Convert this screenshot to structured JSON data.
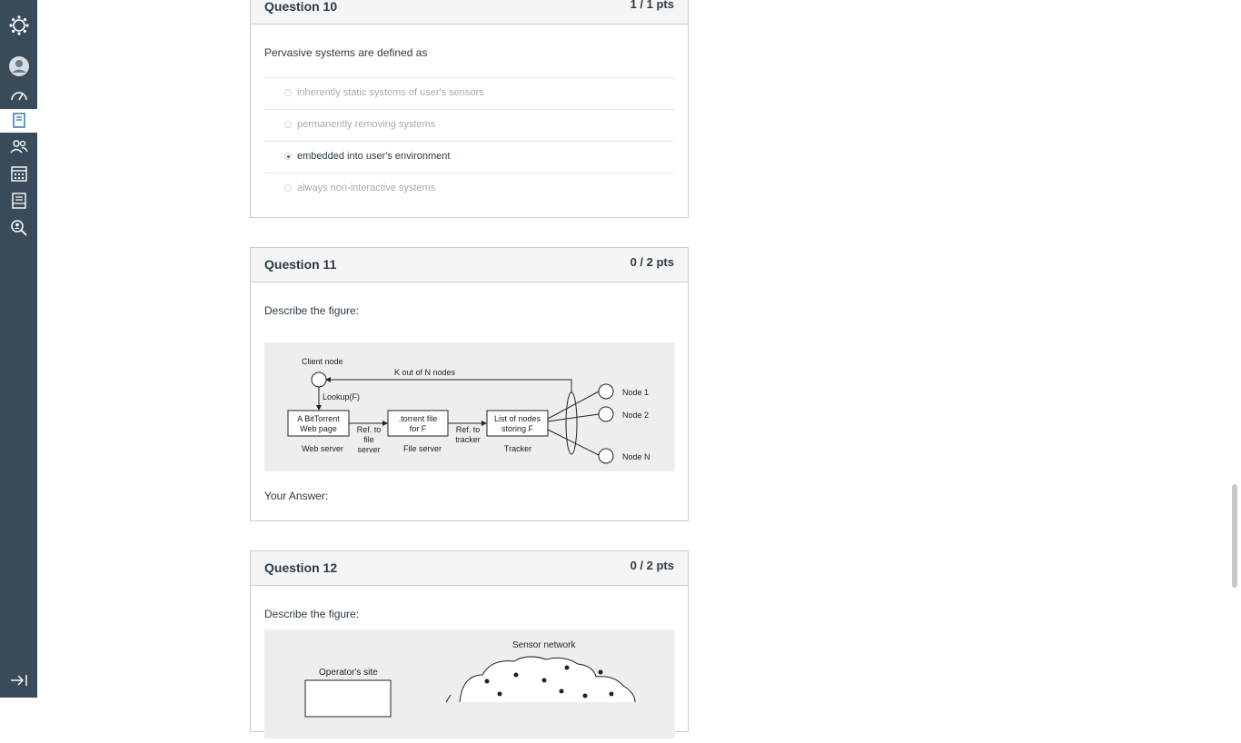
{
  "nav": {
    "items": [
      "logo-icon",
      "account-icon",
      "dashboard-icon",
      "courses-icon",
      "groups-icon",
      "calendar-icon",
      "inbox-icon",
      "help-icon",
      "collapse-icon"
    ],
    "active": "courses-icon"
  },
  "questions": [
    {
      "title": "Question 10",
      "points": "1 / 1 pts",
      "text": "Pervasive systems are defined as",
      "answers": [
        {
          "label": "inherently static systems of user's sensors",
          "selected": false
        },
        {
          "label": "permanently removing systems",
          "selected": false
        },
        {
          "label": "embedded into user's environment",
          "selected": true
        },
        {
          "label": "always non-interactive systems",
          "selected": false
        }
      ]
    },
    {
      "title": "Question 11",
      "points": "0 / 2 pts",
      "text": "Describe the figure:",
      "your_answer": "Your Answer:",
      "figure": {
        "client_node": "Client node",
        "k_out_of_n": "K out of N nodes",
        "lookup": "Lookup(F)",
        "box1": [
          "A  BitTorrent",
          "Web page"
        ],
        "box2": [
          ".torrent file",
          "for F"
        ],
        "box3": [
          "List of nodes",
          "storing F"
        ],
        "ref_file": [
          "Ref. to",
          "file",
          "server"
        ],
        "ref_tracker": [
          "Ref. to",
          "tracker"
        ],
        "web_server": "Web server",
        "file_server": "File server",
        "tracker": "Tracker",
        "node1": "Node 1",
        "node2": "Node 2",
        "nodeN": "Node N"
      }
    },
    {
      "title": "Question 12",
      "points": "0 / 2 pts",
      "text": "Describe the figure:",
      "figure": {
        "sensor_network": "Sensor network",
        "operators_site": "Operator's site"
      }
    }
  ]
}
